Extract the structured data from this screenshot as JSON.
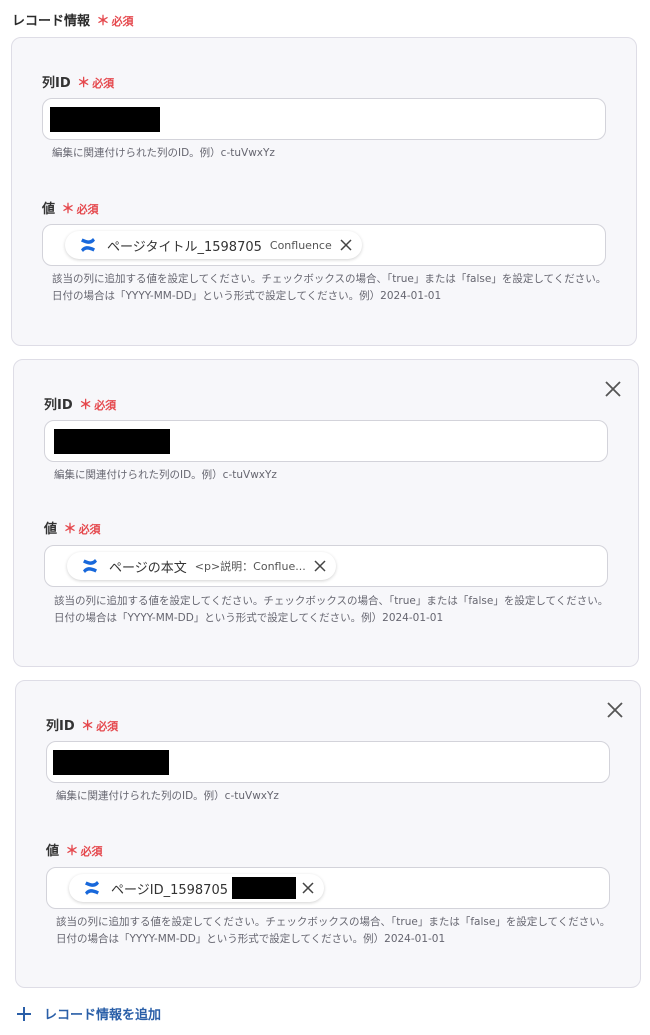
{
  "section": {
    "title": "レコード情報",
    "required_mark": "＊",
    "required_label": "必須"
  },
  "records": [
    {
      "id_label": "列ID",
      "id_help": "編集に関連付けられた列のID。例）c-tuVwxYz",
      "value_label": "値",
      "value_chip": {
        "name": "ページタイトル_1598705",
        "sub": "Confluence"
      },
      "value_help_1": "該当の列に追加する値を設定してください。チェックボックスの場合、「true」または「false」を設定してください。",
      "value_help_2": "日付の場合は「YYYY-MM-DD」という形式で設定してください。例）2024-01-01"
    },
    {
      "id_label": "列ID",
      "id_help": "編集に関連付けられた列のID。例）c-tuVwxYz",
      "value_label": "値",
      "value_chip": {
        "name": "ページの本文",
        "sub": "<p>説明：Conflue..."
      },
      "value_help_1": "該当の列に追加する値を設定してください。チェックボックスの場合、「true」または「false」を設定してください。",
      "value_help_2": "日付の場合は「YYYY-MM-DD」という形式で設定してください。例）2024-01-01"
    },
    {
      "id_label": "列ID",
      "id_help": "編集に関連付けられた列のID。例）c-tuVwxYz",
      "value_label": "値",
      "value_chip": {
        "name": "ページID_1598705",
        "sub": ""
      },
      "value_help_1": "該当の列に追加する値を設定してください。チェックボックスの場合、「true」または「false」を設定してください。",
      "value_help_2": "日付の場合は「YYYY-MM-DD」という形式で設定してください。例）2024-01-01"
    }
  ],
  "add_button_label": "レコード情報を追加",
  "icons": {
    "chip_service": "confluence-icon",
    "chip_remove": "close-icon",
    "card_remove": "close-icon",
    "add": "plus-icon"
  },
  "colors": {
    "required": "#e5484d",
    "accent": "#2a5fa8",
    "confluence": "#1868db",
    "card_bg": "#f7f7fa"
  }
}
